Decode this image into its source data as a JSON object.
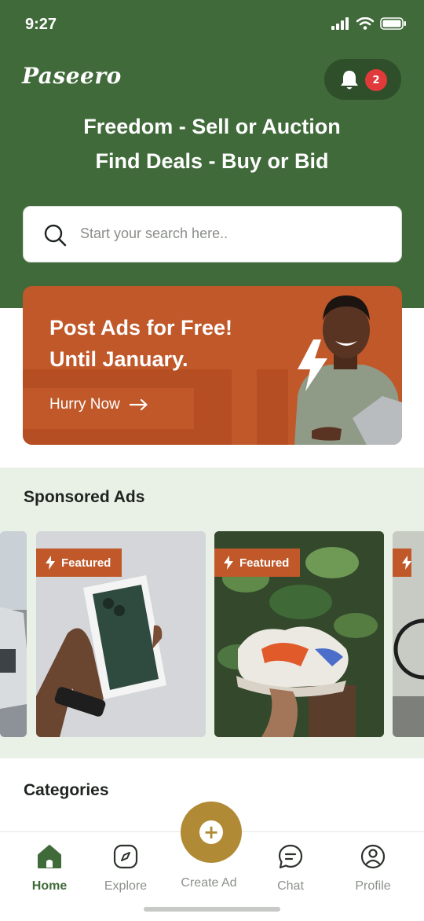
{
  "status_bar": {
    "time": "9:27"
  },
  "header": {
    "logo": "Paseero",
    "notifications": {
      "count": "2"
    },
    "tagline_line1": "Freedom - Sell or Auction",
    "tagline_line2": "Find Deals - Buy or Bid"
  },
  "search": {
    "placeholder": "Start your search here.."
  },
  "promo": {
    "title_line1": "Post Ads for Free!",
    "title_line2": "Until January.",
    "cta": "Hurry Now"
  },
  "sponsored": {
    "title": "Sponsored Ads",
    "badge_label": "Featured",
    "cards": [
      {
        "subject": "car"
      },
      {
        "subject": "iphone-box"
      },
      {
        "subject": "sneakers"
      },
      {
        "subject": "bicycle"
      }
    ]
  },
  "categories": {
    "title": "Categories"
  },
  "bottom_nav": {
    "items": [
      {
        "label": "Home",
        "active": true
      },
      {
        "label": "Explore"
      },
      {
        "label": "Create Ad"
      },
      {
        "label": "Chat"
      },
      {
        "label": "Profile"
      }
    ]
  },
  "colors": {
    "brand_green": "#406a3a",
    "promo_orange": "#c0582a",
    "fab_gold": "#b08a35",
    "badge_red": "#e03a3a"
  }
}
